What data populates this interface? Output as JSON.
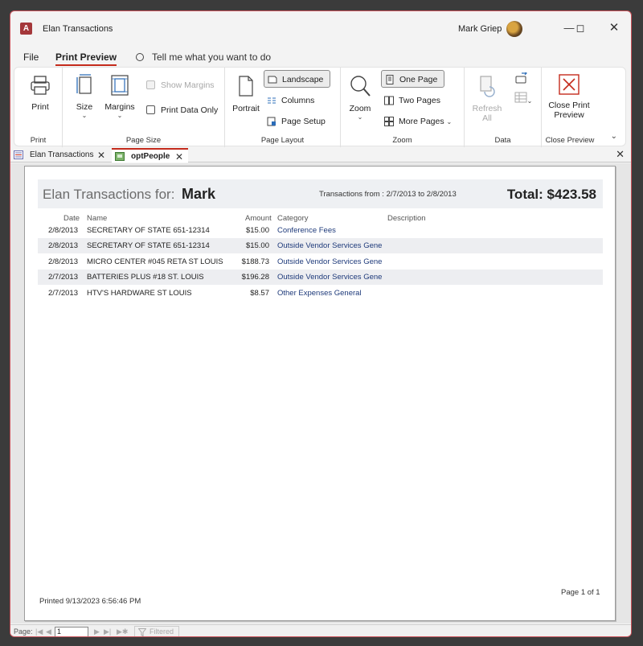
{
  "window": {
    "title": "Elan Transactions",
    "user": "Mark Griep",
    "app_icon_letter": "A"
  },
  "menu": {
    "file": "File",
    "print_preview": "Print Preview",
    "tell_me": "Tell me what you want to do"
  },
  "ribbon": {
    "print": {
      "print_label": "Print",
      "group": "Print"
    },
    "page_size": {
      "size_label": "Size",
      "margins_label": "Margins",
      "show_margins_label": "Show Margins",
      "print_data_only_label": "Print Data Only",
      "group": "Page Size"
    },
    "page_layout": {
      "portrait_label": "Portrait",
      "landscape_label": "Landscape",
      "columns_label": "Columns",
      "page_setup_label": "Page Setup",
      "group": "Page Layout"
    },
    "zoom": {
      "zoom_label": "Zoom",
      "one_page_label": "One Page",
      "two_pages_label": "Two Pages",
      "more_pages_label": "More Pages",
      "group": "Zoom"
    },
    "data": {
      "refresh_label_1": "Refresh",
      "refresh_label_2": "All",
      "group": "Data"
    },
    "close": {
      "close_label_1": "Close Print",
      "close_label_2": "Preview",
      "group": "Close Preview"
    }
  },
  "doc_tabs": [
    {
      "label": "Elan Transactions"
    },
    {
      "label": "optPeople"
    }
  ],
  "report": {
    "title": "Elan Transactions for:",
    "name": "Mark",
    "range": "Transactions from : 2/7/2013 to 2/8/2013",
    "total": "Total: $423.58",
    "columns": {
      "date": "Date",
      "name": "Name",
      "amount": "Amount",
      "category": "Category",
      "description": "Description"
    },
    "rows": [
      {
        "date": "2/8/2013",
        "name": "SECRETARY OF STATE 651-12314",
        "amount": "$15.00",
        "category": "Conference Fees"
      },
      {
        "date": "2/8/2013",
        "name": "SECRETARY OF STATE 651-12314",
        "amount": "$15.00",
        "category": "Outside Vendor Services Gene"
      },
      {
        "date": "2/8/2013",
        "name": "MICRO CENTER #045 RETA ST LOUIS",
        "amount": "$188.73",
        "category": "Outside Vendor Services Gene"
      },
      {
        "date": "2/7/2013",
        "name": "BATTERIES PLUS #18 ST. LOUIS",
        "amount": "$196.28",
        "category": "Outside Vendor Services Gene"
      },
      {
        "date": "2/7/2013",
        "name": "HTV'S HARDWARE ST LOUIS",
        "amount": "$8.57",
        "category": "Other Expenses General"
      }
    ],
    "printed": "Printed 9/13/2023 6:56:46 PM",
    "page_of": "Page 1 of 1"
  },
  "status": {
    "page_label": "Page:",
    "page_value": "1",
    "filtered": "Filtered"
  }
}
